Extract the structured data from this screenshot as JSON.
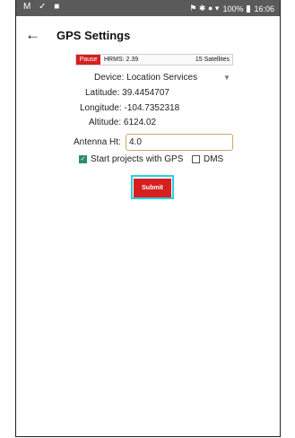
{
  "statusbar": {
    "left_icons": "M ✓ ■",
    "right_icons": "⚑ ✱ ● ▾",
    "battery": "100%",
    "time": "16:06"
  },
  "header": {
    "title": "GPS Settings"
  },
  "gps_status": {
    "pause_label": "Pause",
    "hrms": "HRMS: 2.39",
    "satellites": "15 Satellites"
  },
  "form": {
    "device_label": "Device:",
    "device_value": "Location Services",
    "latitude_label": "Latitude:",
    "latitude_value": "39.4454707",
    "longitude_label": "Longitude:",
    "longitude_value": "-104.7352318",
    "altitude_label": "Altitude:",
    "altitude_value": "6124.02",
    "antenna_label": "Antenna Ht:",
    "antenna_value": "4.0",
    "start_with_gps_label": "Start projects with GPS",
    "start_with_gps_checked": true,
    "dms_label": "DMS",
    "dms_checked": false,
    "submit_label": "Submit"
  },
  "colors": {
    "accent_red": "#d62020",
    "focus_cyan": "#22d3e0",
    "checkbox_green": "#2e8b6e",
    "statusbar_gray": "#5a5a5a"
  }
}
